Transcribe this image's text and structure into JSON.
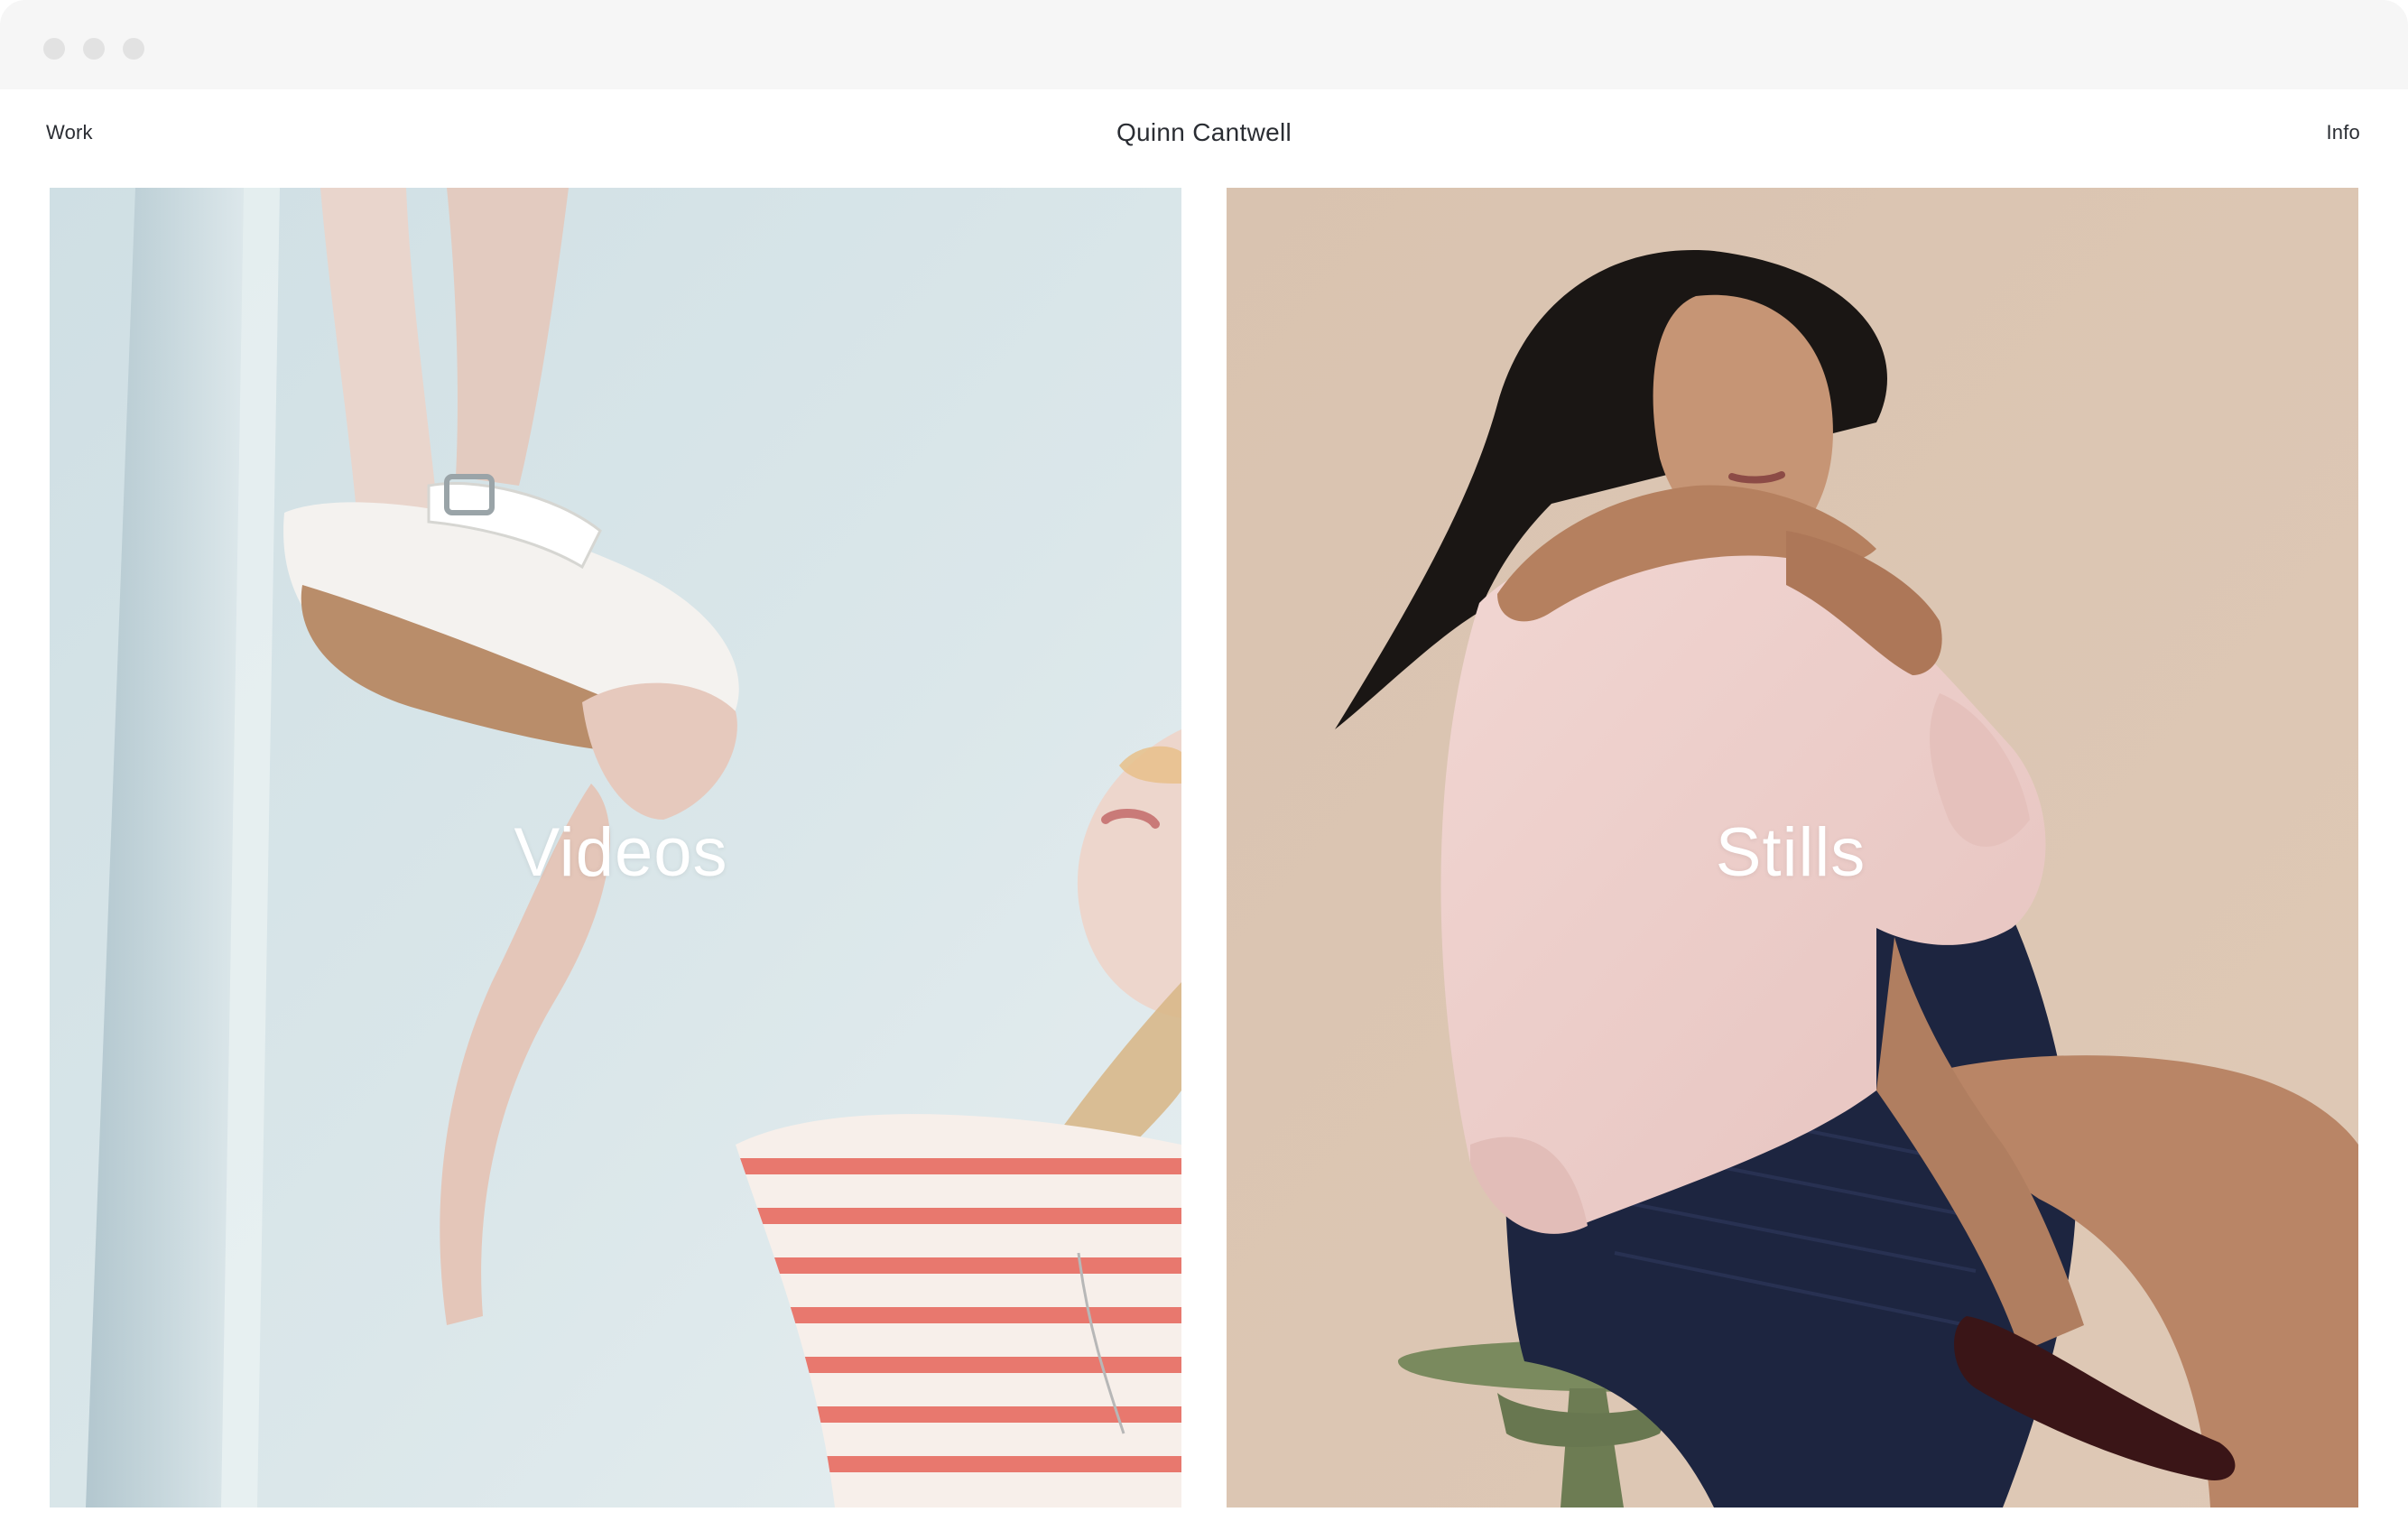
{
  "browser": {
    "window_controls": [
      "close-dot",
      "minimize-dot",
      "maximize-dot"
    ]
  },
  "header": {
    "left_link": "Work",
    "title": "Quinn Cantwell",
    "right_link": "Info"
  },
  "panels": [
    {
      "label": "Videos",
      "image": "girl-in-striped-shirt-holding-sandal",
      "palette": {
        "bg": "#d4e2e6",
        "accent": "#e8786e"
      }
    },
    {
      "label": "Stills",
      "image": "woman-in-pink-sweater-on-stool",
      "palette": {
        "bg": "#dcc6b2",
        "accent": "#efd2cf"
      }
    }
  ]
}
